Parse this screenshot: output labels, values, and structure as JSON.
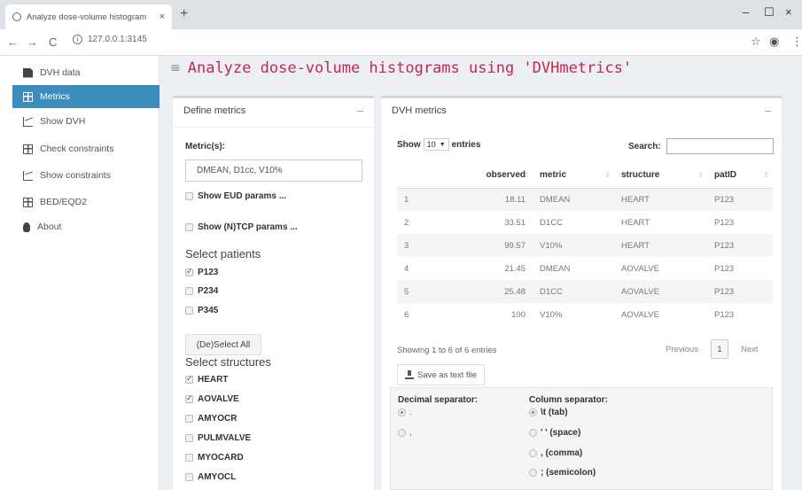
{
  "browser": {
    "tab_title": "Analyze dose-volume histogram",
    "tab_close": "×",
    "new_tab": "+",
    "url": "127.0.0.1:3145",
    "win_min": "–",
    "win_max": "☐",
    "win_close": "×",
    "back": "←",
    "forward": "→",
    "reload": "C",
    "info": "i",
    "star": "☆",
    "profile": "◉",
    "menu": "⋮"
  },
  "sidebar": {
    "items": [
      {
        "label": "DVH data",
        "icon": "file-icon"
      },
      {
        "label": "Metrics",
        "icon": "table-icon"
      },
      {
        "label": "Show DVH",
        "icon": "chart-icon"
      },
      {
        "label": "Check constraints",
        "icon": "table-icon"
      },
      {
        "label": "Show constraints",
        "icon": "chart-icon"
      },
      {
        "label": "BED/EQD2",
        "icon": "table-icon"
      },
      {
        "label": "About",
        "icon": "lightbulb-icon"
      }
    ],
    "active_index": 1,
    "accent_color": "#3c8dbc"
  },
  "header": {
    "menu_icon": "≡",
    "title": "Analyze dose-volume histograms using 'DVHmetrics'"
  },
  "define_box": {
    "title": "Define metrics",
    "collapse": "–",
    "metrics_label": "Metric(s):",
    "metrics_value": "DMEAN, D1cc, V10%",
    "show_eud": "Show EUD params ...",
    "show_ntcp": "Show (N)TCP params ...",
    "patients_title": "Select patients",
    "patients": [
      {
        "label": "P123",
        "checked": true
      },
      {
        "label": "P234",
        "checked": false
      },
      {
        "label": "P345",
        "checked": false
      }
    ],
    "deselect_all": "(De)Select All",
    "structures_title": "Select structures",
    "structures": [
      {
        "label": "HEART",
        "checked": true
      },
      {
        "label": "AOVALVE",
        "checked": true
      },
      {
        "label": "AMYOCR",
        "checked": false
      },
      {
        "label": "PULMVALVE",
        "checked": false
      },
      {
        "label": "MYOCARD",
        "checked": false
      },
      {
        "label": "AMYOCL",
        "checked": false
      }
    ]
  },
  "dvh_box": {
    "title": "DVH metrics",
    "collapse": "–",
    "show": "Show",
    "entries_value": "10",
    "entries": "entries",
    "search_label": "Search:",
    "columns": [
      "",
      "observed",
      "metric",
      "structure",
      "patID"
    ],
    "rows": [
      [
        "1",
        "18.11",
        "DMEAN",
        "HEART",
        "P123"
      ],
      [
        "2",
        "33.51",
        "D1CC",
        "HEART",
        "P123"
      ],
      [
        "3",
        "99.57",
        "V10%",
        "HEART",
        "P123"
      ],
      [
        "4",
        "21.45",
        "DMEAN",
        "AOVALVE",
        "P123"
      ],
      [
        "5",
        "25.48",
        "D1CC",
        "AOVALVE",
        "P123"
      ],
      [
        "6",
        "100",
        "V10%",
        "AOVALVE",
        "P123"
      ]
    ],
    "info": "Showing 1 to 6 of 6 entries",
    "prev": "Previous",
    "page": "1",
    "next": "Next",
    "save": "Save as text file",
    "decimal_label": "Decimal separator:",
    "decimal_options": [
      {
        "label": ".",
        "selected": true
      },
      {
        "label": ",",
        "selected": false
      }
    ],
    "column_label": "Column separator:",
    "column_options": [
      {
        "label": "\\t (tab)",
        "selected": true
      },
      {
        "label": "' ' (space)",
        "selected": false
      },
      {
        "label": ", (comma)",
        "selected": false
      },
      {
        "label": "; (semicolon)",
        "selected": false
      }
    ]
  }
}
